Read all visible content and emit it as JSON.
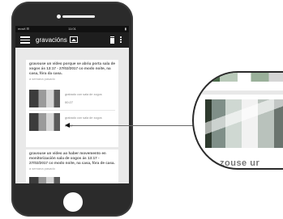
{
  "statusbar": {
    "carrier": "movil ☰",
    "time": "11:01",
    "battery": "▮"
  },
  "appbar": {
    "title": "gravacións"
  },
  "recordings": [
    {
      "text": "gravouse un vídeo porque se abriu porta sala de xogos ás 13:17 - 27/02/2017 co modo noite, na casa, fóra da casa.",
      "time_ago": "a semana pasado",
      "items": [
        {
          "label": "grabado con sala de xogos",
          "duration": "00:27"
        },
        {
          "label": "grabado con sala de xogos",
          "duration": "00:27"
        }
      ]
    },
    {
      "text": "gravouse un vídeo ao haber movemento en monitorización sala de xogos ás 13:17 - 27/02/2017 co modo noite, na casa, fóra de casa.",
      "time_ago": "a semana pasado",
      "items": [
        {
          "label": "",
          "duration": ""
        }
      ]
    }
  ],
  "zoom": {
    "caption": "zouse ur"
  }
}
